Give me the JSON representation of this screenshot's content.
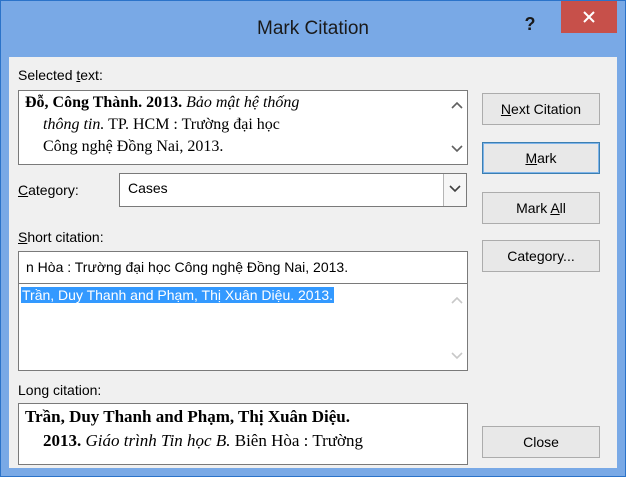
{
  "window": {
    "title": "Mark Citation",
    "help_glyph": "?",
    "close_icon": "close-icon"
  },
  "selected_text": {
    "label_pre": "Selected ",
    "label_key": "t",
    "label_post": "ext:",
    "line1_bold": "Đỗ, Công Thành. 2013.",
    "line1_italic": "Bảo mật hệ thống",
    "line2_italic": "thông tin.",
    "line2_rest": "TP. HCM : Trường đại học",
    "line3": "Công nghệ Đồng Nai, 2013."
  },
  "category": {
    "label_key": "C",
    "label_post": "ategory:",
    "value": "Cases"
  },
  "short_citation": {
    "label_key": "S",
    "label_post": "hort citation:",
    "input_value": "n Hòa : Trường đại học Công nghệ Đồng Nai, 2013.",
    "list_items": [
      "Trần, Duy Thanh and Phạm, Thị Xuân Diệu. 2013."
    ]
  },
  "long_citation": {
    "label": "Long citation:",
    "line1_bold": "Trần, Duy Thanh and Phạm, Thị Xuân Diệu.",
    "line2_bold": "2013.",
    "line2_italic": "Giáo trình Tin học B.",
    "line2_rest": "Biên Hòa : Trường"
  },
  "buttons": {
    "next_key": "N",
    "next_post": "ext Citation",
    "mark_key": "M",
    "mark_post": "ark",
    "markall_pre": "Mark ",
    "markall_key": "A",
    "markall_post": "ll",
    "category_pre": "Cate",
    "category_key": "g",
    "category_post": "ory...",
    "close": "Close"
  },
  "colors": {
    "titlebar": "#79a9e6",
    "close_button": "#c7504a",
    "selection": "#3399ff",
    "dialog_face": "#f0f0f0"
  }
}
